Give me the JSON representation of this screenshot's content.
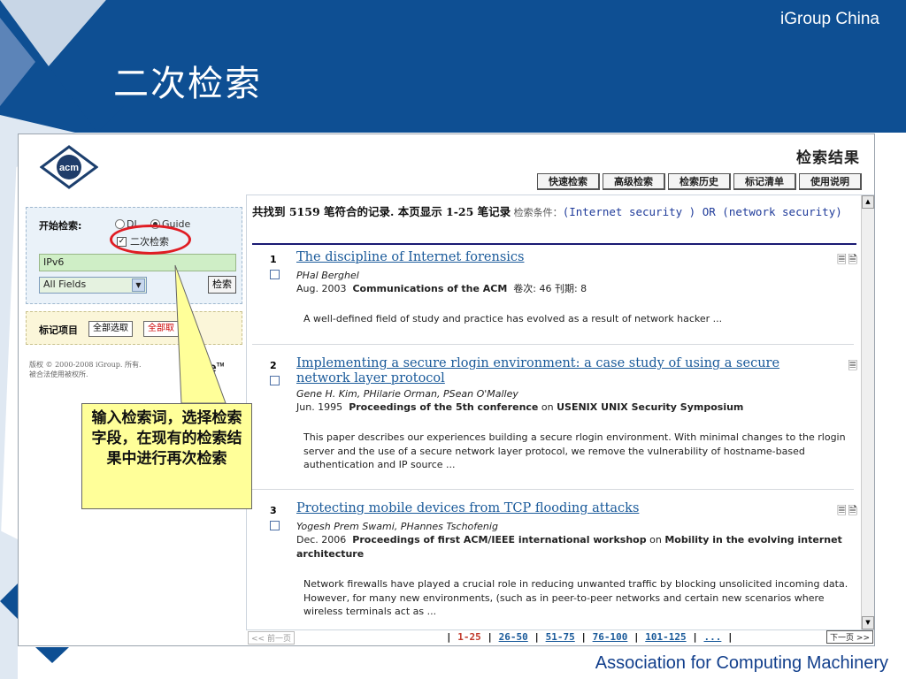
{
  "slide": {
    "brand": "iGroup China",
    "title": "二次检索",
    "footer": "Association for Computing Machinery"
  },
  "acm": {
    "logo_text": "acm",
    "results_title": "检索结果",
    "nav": [
      "快速检索",
      "高级检索",
      "检索历史",
      "标记清单",
      "使用说明"
    ]
  },
  "search_panel": {
    "start_label": "开始检索:",
    "radio_dl": "DL",
    "radio_guide": "Guide",
    "selected": "Guide",
    "second_search_label": "二次检索",
    "second_search_checked": true,
    "query_value": "IPv6",
    "field_value": "All Fields",
    "search_button": "检索"
  },
  "mark_panel": {
    "label": "标记项目",
    "select_all": "全部选取",
    "clear_all": "全部取"
  },
  "copyright": "版权 © 2000-2008 iGroup. 所有. 被合法使用被权所.",
  "ge_logo": "ge",
  "callout": "输入检索词，选择检索字段，在现有的检索结果中进行再次检索",
  "summary": {
    "prefix": "共找到 5159 笔符合的记录. 本页显示 1-25 笔记录",
    "cond_label": " 检索条件：",
    "query": "(Internet security ) OR (network security)"
  },
  "results": [
    {
      "num": "1",
      "title": "The discipline of Internet forensics",
      "icons": "🗏🗎",
      "authors": "PHal Berghel",
      "venue_date": "Aug. 2003",
      "venue_name": "Communications of the ACM",
      "venue_extra": "卷次: 46 刊期: 8",
      "abstract": "A well-defined field of study and practice has evolved as a result of network hacker ..."
    },
    {
      "num": "2",
      "title": "Implementing a secure rlogin environment: a case study of using a secure network layer protocol",
      "icons": "🗏",
      "authors": "Gene H. Kim, PHilarie Orman, PSean O'Malley",
      "venue_date": "Jun. 1995",
      "venue_name": "Proceedings of the 5th conference",
      "venue_on": "on",
      "venue_series": "USENIX UNIX Security Symposium",
      "abstract": "This paper describes our experiences building a secure rlogin environment. With minimal changes to the rlogin server and the use of a secure network layer protocol, we remove the vulnerability of hostname-based authentication and IP source ..."
    },
    {
      "num": "3",
      "title": "Protecting mobile devices from TCP flooding attacks",
      "icons": "🗏🗎",
      "authors": "Yogesh Prem Swami, PHannes Tschofenig",
      "venue_date": "Dec. 2006",
      "venue_name": "Proceedings of first ACM/IEEE international workshop",
      "venue_on": "on",
      "venue_series": "Mobility in the evolving internet architecture",
      "abstract": "Network firewalls have played a crucial role in reducing unwanted traffic by blocking unsolicited incoming data. However, for many new environments, (such as in peer-to-peer networks and certain new scenarios where wireless terminals act as ..."
    }
  ],
  "pager": {
    "prev": "<< 前一页",
    "current": "1-25",
    "pages": [
      "26-50",
      "51-75",
      "76-100",
      "101-125",
      "..."
    ],
    "next": "下一页 >>"
  },
  "colors": {
    "header_blue": "#0e4f93",
    "link": "#1a5a9a",
    "callout_bg": "#ffff99",
    "highlight_ring": "#e01d24"
  }
}
